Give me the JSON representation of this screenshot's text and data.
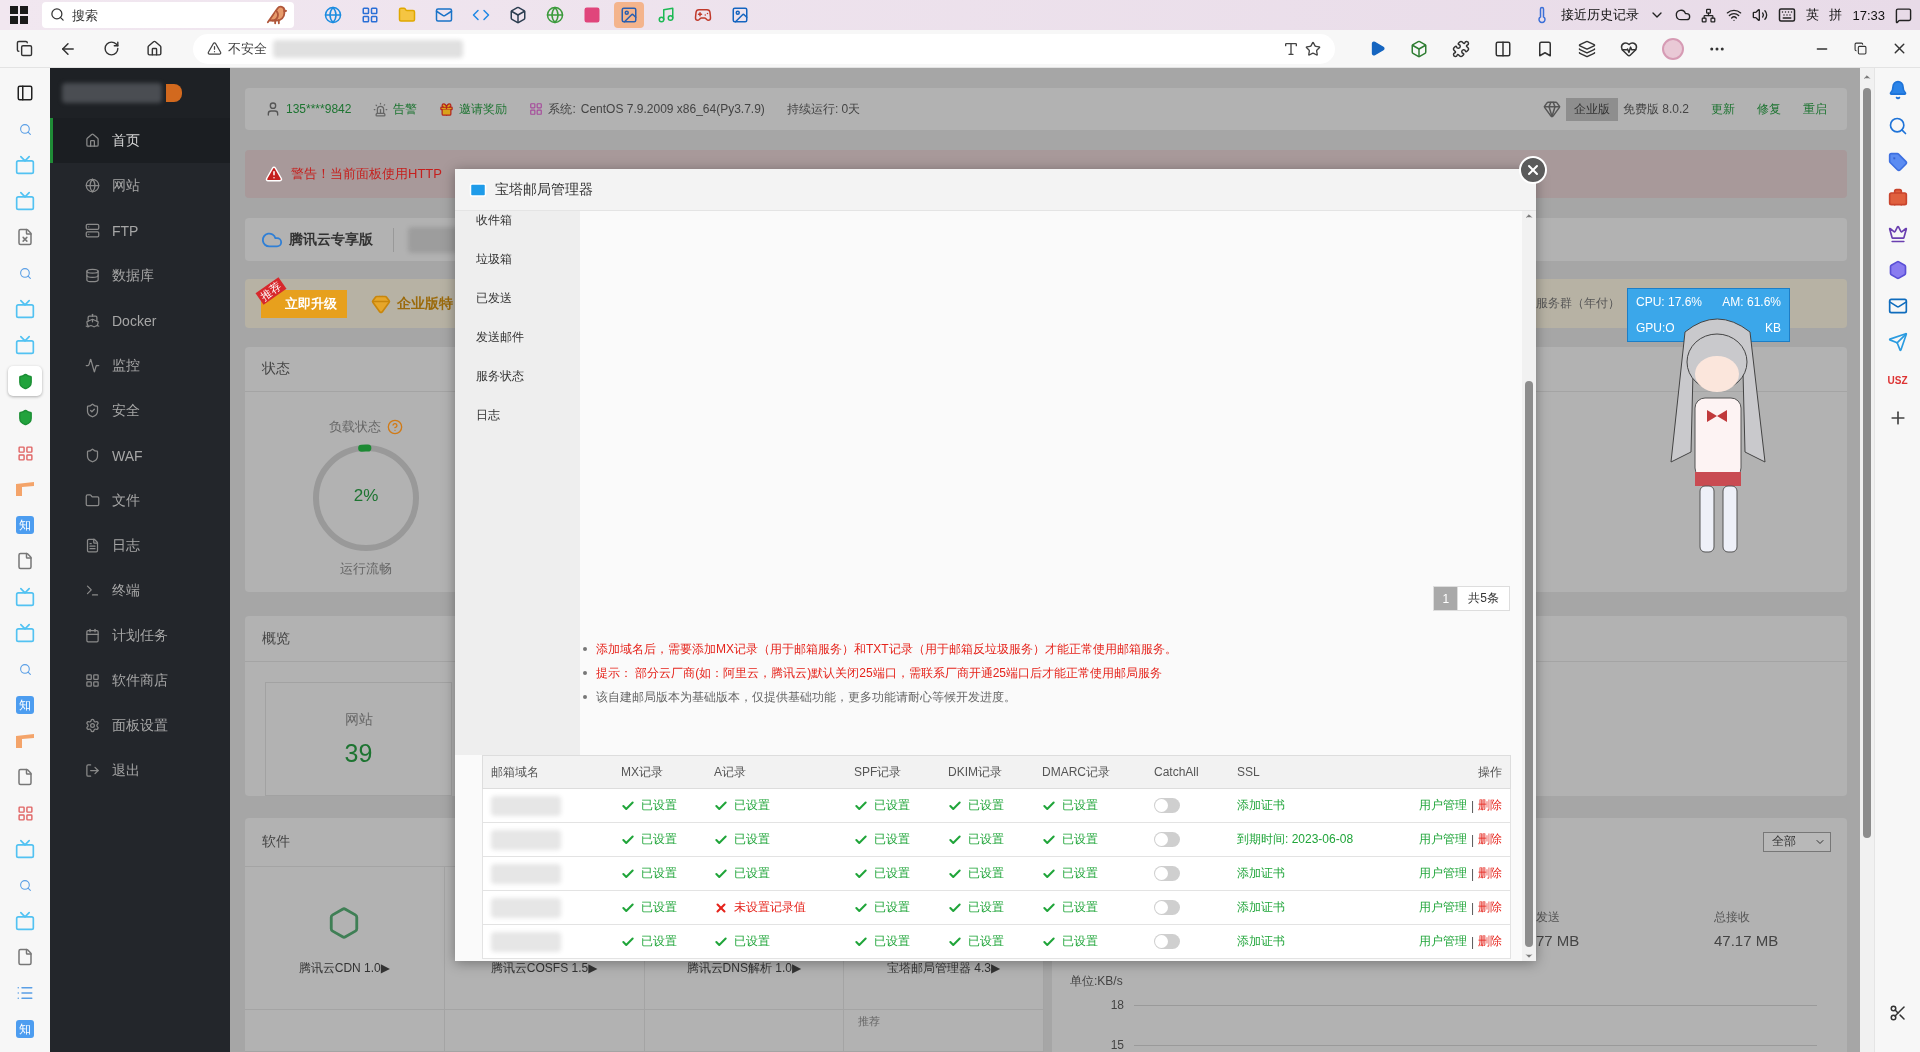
{
  "taskbar": {
    "search_placeholder": "搜索",
    "apps": [
      {
        "kind": "browser",
        "selected": false
      },
      {
        "kind": "store",
        "selected": false
      },
      {
        "kind": "folder",
        "selected": false
      },
      {
        "kind": "mail",
        "selected": false
      },
      {
        "kind": "code",
        "selected": false
      },
      {
        "kind": "app",
        "selected": false
      },
      {
        "kind": "globe",
        "selected": false
      },
      {
        "kind": "tile",
        "selected": false
      },
      {
        "kind": "paint",
        "selected": true
      },
      {
        "kind": "music",
        "selected": false
      },
      {
        "kind": "game",
        "selected": false
      },
      {
        "kind": "photo",
        "selected": false
      }
    ],
    "tray_label": "接近历史记录",
    "ime_lang": "英",
    "ime_mode": "拼",
    "time": "17:33"
  },
  "browser": {
    "security": "不安全"
  },
  "left_rail": [
    {
      "kind": "tab",
      "selected": false
    },
    {
      "kind": "search",
      "selected": false
    },
    {
      "kind": "tv",
      "selected": false
    },
    {
      "kind": "tv",
      "selected": false
    },
    {
      "kind": "file-x",
      "selected": false
    },
    {
      "kind": "search",
      "selected": false
    },
    {
      "kind": "tv",
      "selected": false
    },
    {
      "kind": "tv",
      "selected": false
    },
    {
      "kind": "shield",
      "selected": true
    },
    {
      "kind": "shield",
      "selected": false
    },
    {
      "kind": "grid",
      "selected": false
    },
    {
      "kind": "flag",
      "selected": false
    },
    {
      "kind": "zhi",
      "text": "知",
      "selected": false
    },
    {
      "kind": "file",
      "selected": false
    },
    {
      "kind": "tv",
      "selected": false
    },
    {
      "kind": "tv",
      "selected": false
    },
    {
      "kind": "search",
      "selected": false
    },
    {
      "kind": "zhi",
      "text": "知",
      "selected": false
    },
    {
      "kind": "flag",
      "selected": false
    },
    {
      "kind": "file",
      "selected": false
    },
    {
      "kind": "grid",
      "selected": false
    },
    {
      "kind": "tv",
      "selected": false
    },
    {
      "kind": "search",
      "selected": false
    },
    {
      "kind": "tv",
      "selected": false
    },
    {
      "kind": "file",
      "selected": false
    },
    {
      "kind": "list",
      "selected": false
    },
    {
      "kind": "zhi",
      "text": "知",
      "selected": false
    }
  ],
  "right_rail": [
    {
      "kind": "bell"
    },
    {
      "kind": "search"
    },
    {
      "kind": "tag"
    },
    {
      "kind": "toolbox"
    },
    {
      "kind": "chess"
    },
    {
      "kind": "hexagon"
    },
    {
      "kind": "mail"
    },
    {
      "kind": "send"
    },
    {
      "kind": "text",
      "text": "USZ"
    },
    {
      "kind": "plus"
    }
  ],
  "panel_sidebar": {
    "items": [
      {
        "label": "首页",
        "selected": true
      },
      {
        "label": "网站",
        "selected": false
      },
      {
        "label": "FTP",
        "selected": false
      },
      {
        "label": "数据库",
        "selected": false
      },
      {
        "label": "Docker",
        "selected": false
      },
      {
        "label": "监控",
        "selected": false
      },
      {
        "label": "安全",
        "selected": false
      },
      {
        "label": "WAF",
        "selected": false
      },
      {
        "label": "文件",
        "selected": false
      },
      {
        "label": "日志",
        "selected": false
      },
      {
        "label": "终端",
        "selected": false
      },
      {
        "label": "计划任务",
        "selected": false
      },
      {
        "label": "软件商店",
        "selected": false
      },
      {
        "label": "面板设置",
        "selected": false
      },
      {
        "label": "退出",
        "selected": false
      }
    ]
  },
  "header": {
    "user": "135****9842",
    "alarm": "告警",
    "invite": "邀请奖励",
    "system_label": "系统:",
    "system": "CentOS 7.9.2009 x86_64(Py3.7.9)",
    "uptime": "持续运行: 0天",
    "edition_badge": "企业版",
    "version": "免费版 8.0.2",
    "links": [
      "更新",
      "修复",
      "重启"
    ]
  },
  "warning": "警告！当前面板使用HTTP",
  "cloud_bar": {
    "label": "腾讯云专享版"
  },
  "promo": {
    "ribbon": "推荐",
    "button": "立即升级",
    "privilege": "企业版特",
    "tail": "服务群（年付）"
  },
  "status": {
    "title": "状态",
    "gauge": {
      "label": "负载状态",
      "value": "2%",
      "level": 0.02,
      "caption": "运行流畅"
    }
  },
  "overview": {
    "title": "概览",
    "tile": {
      "label": "网站",
      "value": "39"
    }
  },
  "software": {
    "title": "软件",
    "items": [
      "腾讯云CDN 1.0▶",
      "腾讯云COSFS 1.5▶",
      "腾讯云DNS解析 1.0▶",
      "宝塔邮局管理器 4.3▶"
    ],
    "tag": "推荐"
  },
  "traffic": {
    "filter": "全部",
    "sent_label": "发送",
    "sent": "77 MB",
    "recv_label": "总接收",
    "recv": "47.17 MB",
    "unit": "单位:KB/s",
    "yticks": [
      "18",
      "15"
    ]
  },
  "monitor_widget": {
    "cpu": "CPU: 17.6%",
    "ram": "AM: 61.6%",
    "gpu": "GPU:O",
    "net": "KB"
  },
  "modal": {
    "title": "宝塔邮局管理器",
    "menu": [
      {
        "label": "收件箱",
        "selected": false
      },
      {
        "label": "垃圾箱",
        "selected": false
      },
      {
        "label": "已发送",
        "selected": false
      },
      {
        "label": "发送邮件",
        "selected": false
      },
      {
        "label": "服务状态",
        "selected": false
      },
      {
        "label": "日志",
        "selected": false
      }
    ],
    "pagination": {
      "pages": [
        {
          "label": "1",
          "selected": true
        }
      ],
      "total": "共5条"
    },
    "notes": [
      {
        "kind": "warning",
        "text": "添加域名后，需要添加MX记录（用于邮箱服务）和TXT记录（用于邮箱反垃圾服务）才能正常使用邮箱服务。"
      },
      {
        "kind": "warning",
        "text": "提示： 部分云厂商(如：阿里云，腾讯云)默认关闭25端口，需联系厂商开通25端口后才能正常使用邮局服务"
      },
      {
        "kind": "info",
        "text": "该自建邮局版本为基础版本，仅提供基础功能，更多功能请耐心等候开发进度。"
      }
    ],
    "table": {
      "columns": [
        "邮箱域名",
        "MX记录",
        "A记录",
        "SPF记录",
        "DKIM记录",
        "DMARC记录",
        "CatchAll",
        "SSL",
        "操作"
      ],
      "rows": [
        {
          "records": [
            {
              "label": "已设置",
              "set": true
            },
            {
              "label": "已设置",
              "set": true
            },
            {
              "label": "已设置",
              "set": true
            },
            {
              "label": "已设置",
              "set": true
            },
            {
              "label": "已设置",
              "set": true
            }
          ],
          "catchall_on": false,
          "ssl": "添加证书",
          "actions": [
            "用户管理",
            "删除"
          ],
          "separator": "|"
        },
        {
          "records": [
            {
              "label": "已设置",
              "set": true
            },
            {
              "label": "已设置",
              "set": true
            },
            {
              "label": "已设置",
              "set": true
            },
            {
              "label": "已设置",
              "set": true
            },
            {
              "label": "已设置",
              "set": true
            }
          ],
          "catchall_on": false,
          "ssl": "到期时间: 2023-06-08",
          "actions": [
            "用户管理",
            "删除"
          ],
          "separator": "|"
        },
        {
          "records": [
            {
              "label": "已设置",
              "set": true
            },
            {
              "label": "已设置",
              "set": true
            },
            {
              "label": "已设置",
              "set": true
            },
            {
              "label": "已设置",
              "set": true
            },
            {
              "label": "已设置",
              "set": true
            }
          ],
          "catchall_on": false,
          "ssl": "添加证书",
          "actions": [
            "用户管理",
            "删除"
          ],
          "separator": "|"
        },
        {
          "records": [
            {
              "label": "已设置",
              "set": true
            },
            {
              "label": "未设置记录值",
              "set": false
            },
            {
              "label": "已设置",
              "set": true
            },
            {
              "label": "已设置",
              "set": true
            },
            {
              "label": "已设置",
              "set": true
            }
          ],
          "catchall_on": false,
          "ssl": "添加证书",
          "actions": [
            "用户管理",
            "删除"
          ],
          "separator": "|"
        },
        {
          "records": [
            {
              "label": "已设置",
              "set": true
            },
            {
              "label": "已设置",
              "set": true
            },
            {
              "label": "已设置",
              "set": true
            },
            {
              "label": "已设置",
              "set": true
            },
            {
              "label": "已设置",
              "set": true
            }
          ],
          "catchall_on": false,
          "ssl": "添加证书",
          "actions": [
            "用户管理",
            "删除"
          ],
          "separator": "|"
        }
      ]
    }
  }
}
